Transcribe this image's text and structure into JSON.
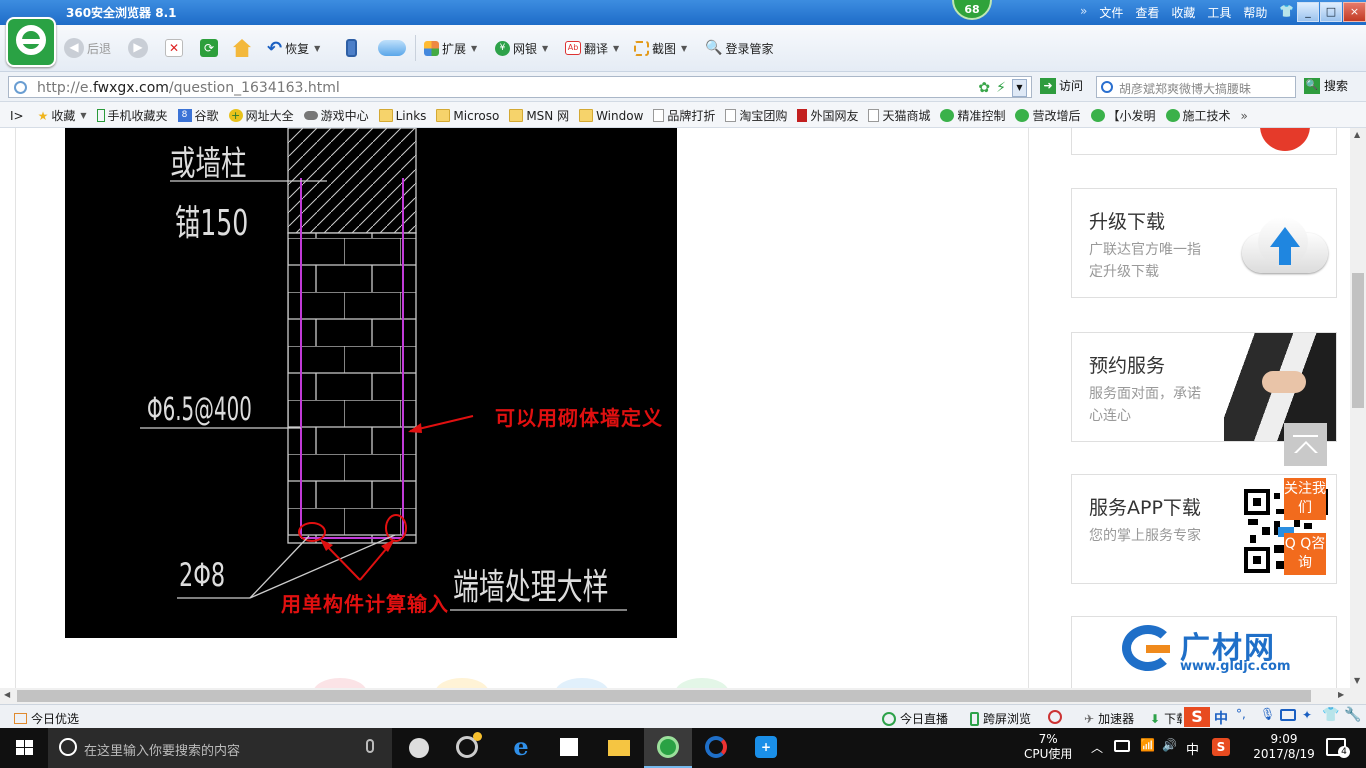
{
  "browser": {
    "title": "360安全浏览器 8.1",
    "badge": "68",
    "menu": [
      "文件",
      "查看",
      "收藏",
      "工具",
      "帮助"
    ],
    "window_buttons": [
      "_",
      "□",
      "×"
    ]
  },
  "toolbar": {
    "back": "后退",
    "restore": "恢复",
    "extend": "扩展",
    "netbank": "网银",
    "translate": "翻译",
    "screenshot": "截图",
    "login_manager": "登录管家"
  },
  "address": {
    "url_prefix": "http://e.",
    "url_domain": "fwxgx.com",
    "url_path": "/question_1634163.html",
    "visit": "访问",
    "search_placeholder": "胡彦斌郑爽微博大搞腰昧",
    "search_button": "搜索"
  },
  "favorites": [
    {
      "label": "收藏",
      "icon": "star-icon"
    },
    {
      "label": "手机收藏夹",
      "icon": "phone-icon"
    },
    {
      "label": "谷歌",
      "icon": "google-icon"
    },
    {
      "label": "网址大全",
      "icon": "plus-icon"
    },
    {
      "label": "游戏中心",
      "icon": "gamepad-icon"
    },
    {
      "label": "Links",
      "icon": "folder-icon"
    },
    {
      "label": "Microso",
      "icon": "folder-icon"
    },
    {
      "label": "MSN 网",
      "icon": "folder-icon"
    },
    {
      "label": "Window",
      "icon": "folder-icon"
    },
    {
      "label": "品牌打折",
      "icon": "page-icon"
    },
    {
      "label": "淘宝团购",
      "icon": "page-icon"
    },
    {
      "label": "外国网友",
      "icon": "flag-icon"
    },
    {
      "label": "天猫商城",
      "icon": "page-icon"
    },
    {
      "label": "精准控制",
      "icon": "wechat-icon"
    },
    {
      "label": "营改增后",
      "icon": "wechat-icon"
    },
    {
      "label": "【小发明",
      "icon": "wechat-icon"
    },
    {
      "label": "施工技术",
      "icon": "wechat-icon"
    }
  ],
  "drawing": {
    "label_column": "或墙柱",
    "label_anchor": "锚150",
    "label_rebar": "Φ6.5@400",
    "label_bottom_bars": "2Φ8",
    "label_title": "端墙处理大样",
    "annotation_masonry": "可以用砌体墙定义",
    "annotation_single": "用单构件计算输入"
  },
  "sidebar": {
    "upgrade_title": "升级下载",
    "upgrade_sub": "广联达官方唯一指定升级下载",
    "appoint_title": "预约服务",
    "appoint_sub": "服务面对面，承诺心连心",
    "app_title": "服务APP下载",
    "app_sub": "您的掌上服务专家",
    "follow": "关注我们",
    "qq": "Q Q咨询",
    "brand_cn": "广材网",
    "brand_url": "www.gldjc.com"
  },
  "statusbar": {
    "today_pick": "今日优选",
    "live": "今日直播",
    "cross_screen": "跨屏浏览",
    "accelerator": "加速器",
    "download": "下载",
    "ime": "中"
  },
  "taskbar": {
    "search_placeholder": "在这里输入你要搜索的内容",
    "cpu_percent": "7%",
    "cpu_label": "CPU使用",
    "ime": "中",
    "time": "9:09",
    "date": "2017/8/19",
    "notifications": "4"
  }
}
